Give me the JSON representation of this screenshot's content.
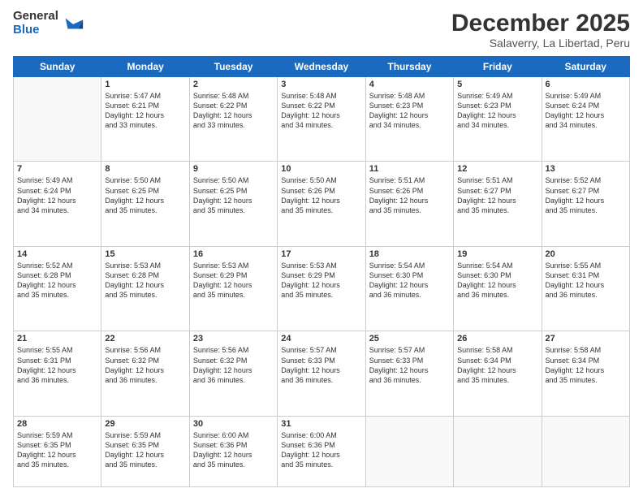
{
  "logo": {
    "general": "General",
    "blue": "Blue"
  },
  "header": {
    "month": "December 2025",
    "location": "Salaverry, La Libertad, Peru"
  },
  "weekdays": [
    "Sunday",
    "Monday",
    "Tuesday",
    "Wednesday",
    "Thursday",
    "Friday",
    "Saturday"
  ],
  "weeks": [
    [
      {
        "day": "",
        "content": ""
      },
      {
        "day": "1",
        "content": "Sunrise: 5:47 AM\nSunset: 6:21 PM\nDaylight: 12 hours\nand 33 minutes."
      },
      {
        "day": "2",
        "content": "Sunrise: 5:48 AM\nSunset: 6:22 PM\nDaylight: 12 hours\nand 33 minutes."
      },
      {
        "day": "3",
        "content": "Sunrise: 5:48 AM\nSunset: 6:22 PM\nDaylight: 12 hours\nand 34 minutes."
      },
      {
        "day": "4",
        "content": "Sunrise: 5:48 AM\nSunset: 6:23 PM\nDaylight: 12 hours\nand 34 minutes."
      },
      {
        "day": "5",
        "content": "Sunrise: 5:49 AM\nSunset: 6:23 PM\nDaylight: 12 hours\nand 34 minutes."
      },
      {
        "day": "6",
        "content": "Sunrise: 5:49 AM\nSunset: 6:24 PM\nDaylight: 12 hours\nand 34 minutes."
      }
    ],
    [
      {
        "day": "7",
        "content": "Sunrise: 5:49 AM\nSunset: 6:24 PM\nDaylight: 12 hours\nand 34 minutes."
      },
      {
        "day": "8",
        "content": "Sunrise: 5:50 AM\nSunset: 6:25 PM\nDaylight: 12 hours\nand 35 minutes."
      },
      {
        "day": "9",
        "content": "Sunrise: 5:50 AM\nSunset: 6:25 PM\nDaylight: 12 hours\nand 35 minutes."
      },
      {
        "day": "10",
        "content": "Sunrise: 5:50 AM\nSunset: 6:26 PM\nDaylight: 12 hours\nand 35 minutes."
      },
      {
        "day": "11",
        "content": "Sunrise: 5:51 AM\nSunset: 6:26 PM\nDaylight: 12 hours\nand 35 minutes."
      },
      {
        "day": "12",
        "content": "Sunrise: 5:51 AM\nSunset: 6:27 PM\nDaylight: 12 hours\nand 35 minutes."
      },
      {
        "day": "13",
        "content": "Sunrise: 5:52 AM\nSunset: 6:27 PM\nDaylight: 12 hours\nand 35 minutes."
      }
    ],
    [
      {
        "day": "14",
        "content": "Sunrise: 5:52 AM\nSunset: 6:28 PM\nDaylight: 12 hours\nand 35 minutes."
      },
      {
        "day": "15",
        "content": "Sunrise: 5:53 AM\nSunset: 6:28 PM\nDaylight: 12 hours\nand 35 minutes."
      },
      {
        "day": "16",
        "content": "Sunrise: 5:53 AM\nSunset: 6:29 PM\nDaylight: 12 hours\nand 35 minutes."
      },
      {
        "day": "17",
        "content": "Sunrise: 5:53 AM\nSunset: 6:29 PM\nDaylight: 12 hours\nand 35 minutes."
      },
      {
        "day": "18",
        "content": "Sunrise: 5:54 AM\nSunset: 6:30 PM\nDaylight: 12 hours\nand 36 minutes."
      },
      {
        "day": "19",
        "content": "Sunrise: 5:54 AM\nSunset: 6:30 PM\nDaylight: 12 hours\nand 36 minutes."
      },
      {
        "day": "20",
        "content": "Sunrise: 5:55 AM\nSunset: 6:31 PM\nDaylight: 12 hours\nand 36 minutes."
      }
    ],
    [
      {
        "day": "21",
        "content": "Sunrise: 5:55 AM\nSunset: 6:31 PM\nDaylight: 12 hours\nand 36 minutes."
      },
      {
        "day": "22",
        "content": "Sunrise: 5:56 AM\nSunset: 6:32 PM\nDaylight: 12 hours\nand 36 minutes."
      },
      {
        "day": "23",
        "content": "Sunrise: 5:56 AM\nSunset: 6:32 PM\nDaylight: 12 hours\nand 36 minutes."
      },
      {
        "day": "24",
        "content": "Sunrise: 5:57 AM\nSunset: 6:33 PM\nDaylight: 12 hours\nand 36 minutes."
      },
      {
        "day": "25",
        "content": "Sunrise: 5:57 AM\nSunset: 6:33 PM\nDaylight: 12 hours\nand 36 minutes."
      },
      {
        "day": "26",
        "content": "Sunrise: 5:58 AM\nSunset: 6:34 PM\nDaylight: 12 hours\nand 35 minutes."
      },
      {
        "day": "27",
        "content": "Sunrise: 5:58 AM\nSunset: 6:34 PM\nDaylight: 12 hours\nand 35 minutes."
      }
    ],
    [
      {
        "day": "28",
        "content": "Sunrise: 5:59 AM\nSunset: 6:35 PM\nDaylight: 12 hours\nand 35 minutes."
      },
      {
        "day": "29",
        "content": "Sunrise: 5:59 AM\nSunset: 6:35 PM\nDaylight: 12 hours\nand 35 minutes."
      },
      {
        "day": "30",
        "content": "Sunrise: 6:00 AM\nSunset: 6:36 PM\nDaylight: 12 hours\nand 35 minutes."
      },
      {
        "day": "31",
        "content": "Sunrise: 6:00 AM\nSunset: 6:36 PM\nDaylight: 12 hours\nand 35 minutes."
      },
      {
        "day": "",
        "content": ""
      },
      {
        "day": "",
        "content": ""
      },
      {
        "day": "",
        "content": ""
      }
    ]
  ]
}
